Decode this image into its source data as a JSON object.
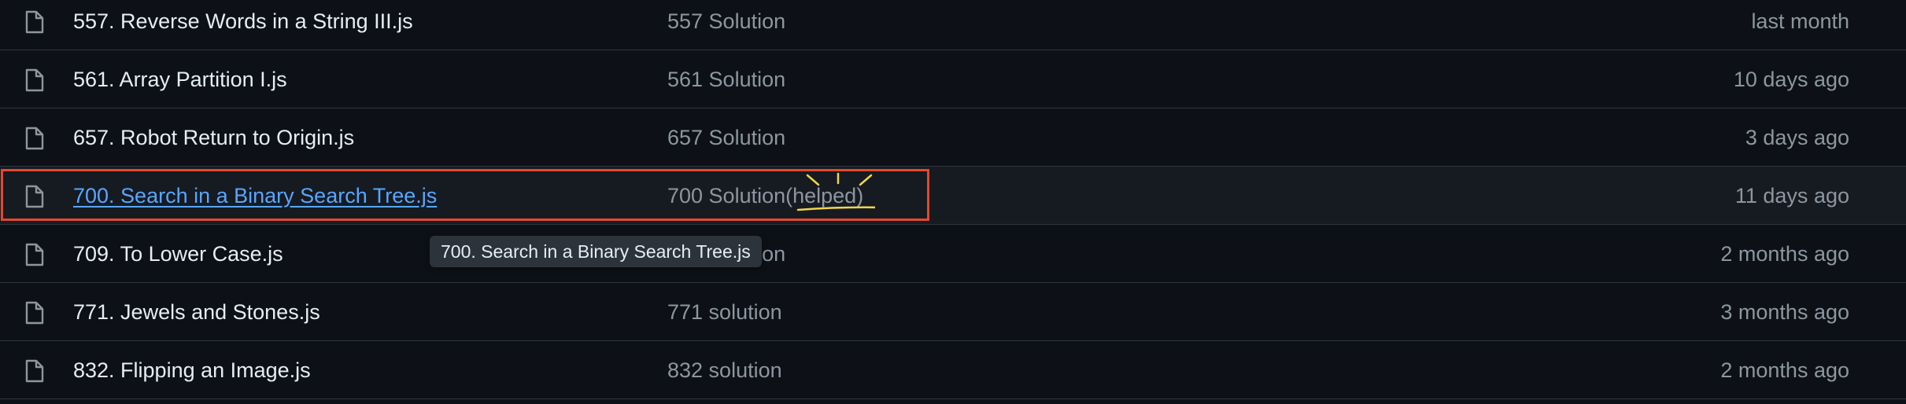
{
  "colors": {
    "background": "#0d1117",
    "row_highlight": "#161b22",
    "border": "#30363d",
    "text_primary": "#e6edf3",
    "text_muted": "#8d96a0",
    "link": "#58a6ff",
    "annotation_box": "#e5482b",
    "annotation_mark": "#f2d54a"
  },
  "files": [
    {
      "icon": "file-icon",
      "name": "557. Reverse Words in a String III.js",
      "commit_message": "557 Solution",
      "date": "last month"
    },
    {
      "icon": "file-icon",
      "name": "561. Array Partition I.js",
      "commit_message": "561 Solution",
      "date": "10 days ago"
    },
    {
      "icon": "file-icon",
      "name": "657. Robot Return to Origin.js",
      "commit_message": "657 Solution",
      "date": "3 days ago"
    },
    {
      "icon": "file-icon",
      "name": "700. Search in a Binary Search Tree.js",
      "commit_message": "700 Solution",
      "commit_annotation": "(helped)",
      "date": "11 days ago"
    },
    {
      "icon": "file-icon",
      "name": "709. To Lower Case.js",
      "commit_message": "709 Solution",
      "date": "2 months ago"
    },
    {
      "icon": "file-icon",
      "name": "771. Jewels and Stones.js",
      "commit_message": "771 solution",
      "date": "3 months ago"
    },
    {
      "icon": "file-icon",
      "name": "832. Flipping an Image.js",
      "commit_message": "832 solution",
      "date": "2 months ago"
    }
  ],
  "tooltip": {
    "text": "700. Search in a Binary Search Tree.js"
  }
}
